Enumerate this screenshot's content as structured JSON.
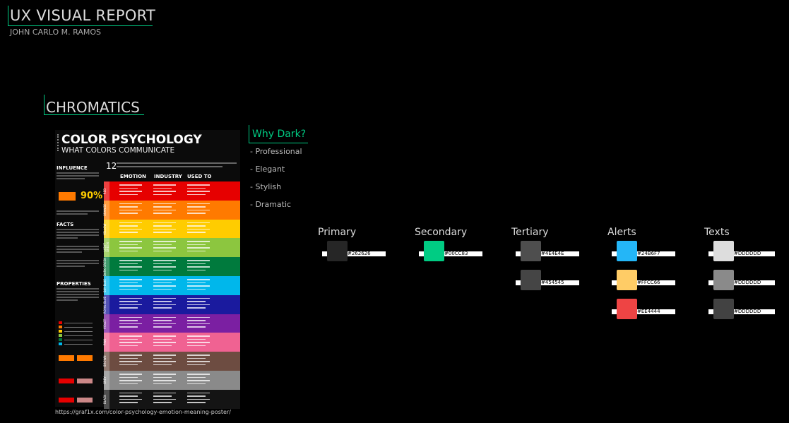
{
  "report": {
    "title": "UX VISUAL REPORT",
    "author": "JOHN CARLO M. RAMOS"
  },
  "chromatics": {
    "title": "CHROMATICS"
  },
  "poster": {
    "title": "COLOR PSYCHOLOGY",
    "subtitle": "WHAT COLORS COMMUNICATE",
    "number": "12",
    "columns": [
      "EMOTION",
      "INDUSTRY",
      "USED TO"
    ],
    "side_headers": [
      "INFLUENCE",
      "FACTS",
      "PROPERTIES"
    ],
    "percent": "90%",
    "url": "https://graf1x.com/color-psychology-emotion-meaning-poster/",
    "rows": [
      {
        "label": "RED",
        "color": "#e60000"
      },
      {
        "label": "ORANGE",
        "color": "#ff7a00"
      },
      {
        "label": "YELLOW",
        "color": "#ffcc00"
      },
      {
        "label": "LIGHT GREEN",
        "color": "#8cc63f"
      },
      {
        "label": "DARK GREEN",
        "color": "#007a3d"
      },
      {
        "label": "SKY BLUE",
        "color": "#00b7eb"
      },
      {
        "label": "ROYAL BLUE",
        "color": "#1a1a9e"
      },
      {
        "label": "VIOLET",
        "color": "#7b1fa2"
      },
      {
        "label": "PINK",
        "color": "#f06292"
      },
      {
        "label": "BROWN",
        "color": "#6d4c41"
      },
      {
        "label": "GREY",
        "color": "#8a8a8a"
      },
      {
        "label": "BLACK",
        "color": "#141414"
      }
    ]
  },
  "why_dark": {
    "title": "Why Dark?",
    "items": [
      "- Professional",
      "- Elegant",
      "- Stylish",
      "- Dramatic"
    ]
  },
  "palette": [
    {
      "title": "Primary",
      "swatches": [
        {
          "label": "#262626",
          "color": "#262626"
        }
      ]
    },
    {
      "title": "Secondary",
      "swatches": [
        {
          "label": "#00CC83",
          "color": "#00CC83"
        }
      ]
    },
    {
      "title": "Tertiary",
      "swatches": [
        {
          "label": "#4E4E4E",
          "color": "#4E4E4E"
        },
        {
          "label": "#454545",
          "color": "#454545"
        }
      ]
    },
    {
      "title": "Alerts",
      "swatches": [
        {
          "label": "#24B6F7",
          "color": "#24B6F7"
        },
        {
          "label": "#FFCC66",
          "color": "#FFCC66"
        },
        {
          "label": "#EE4444",
          "color": "#EE4444"
        }
      ]
    },
    {
      "title": "Texts",
      "swatches": [
        {
          "label": "#DDDDDD",
          "color": "#DDDDDD"
        },
        {
          "label": "#DDDDDD (60%)",
          "color": "#8a8a8a"
        },
        {
          "label": "#DDDDDD (30%)",
          "color": "#424242"
        }
      ]
    }
  ]
}
